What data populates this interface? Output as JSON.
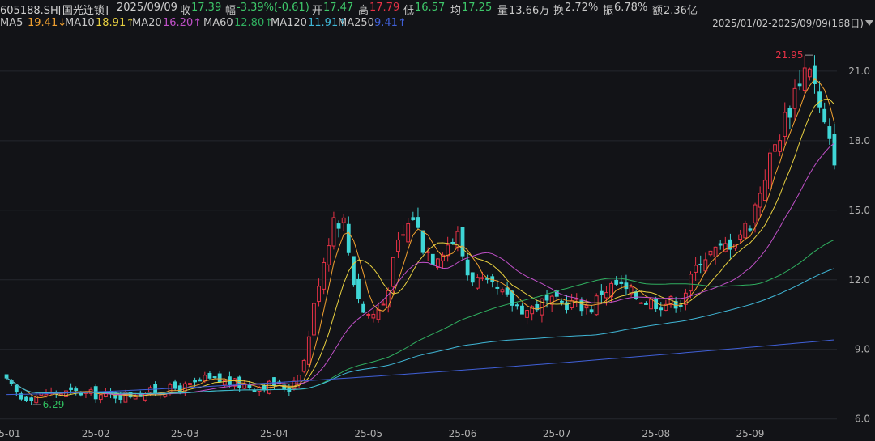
{
  "header": {
    "code": "605188.SH[国光连锁]",
    "date": "2025/09/09",
    "close_label": "收",
    "close": "17.39",
    "change_label": "幅",
    "change": "-3.39%(-0.61)",
    "open_label": "开",
    "open": "17.47",
    "high_label": "高",
    "high": "17.79",
    "low_label": "低",
    "low": "16.57",
    "avg_label": "均",
    "avg": "17.25",
    "volume_label": "量",
    "volume": "13.66万",
    "turnover_label": "换",
    "turnover": "2.72%",
    "amplitude_label": "振",
    "amplitude": "6.78%",
    "amount_label": "额",
    "amount": "2.36亿"
  },
  "ma_legend": [
    {
      "label": "MA5",
      "value": "19.41↓",
      "color": "#f0a030"
    },
    {
      "label": "MA10",
      "value": "18.91↑",
      "color": "#e8d040"
    },
    {
      "label": "MA20",
      "value": "16.20↑",
      "color": "#c050c8"
    },
    {
      "label": "MA60",
      "value": "12.80↑",
      "color": "#30b060"
    },
    {
      "label": "MA120",
      "value": "11.91↑",
      "color": "#40b8d8"
    },
    {
      "label": "MA250",
      "value": "9.41↑",
      "color": "#4060d8"
    }
  ],
  "range_label": "2025/01/02-2025/09/09(168日)",
  "chart_data": {
    "type": "candlestick",
    "y_ticks": [
      "21.0",
      "18.0",
      "15.0",
      "12.0",
      "9.0",
      "6.0"
    ],
    "y_tick_values": [
      21,
      18,
      15,
      12,
      9,
      6
    ],
    "ylim": [
      5.85,
      22.6
    ],
    "x_ticks": [
      "25-01",
      "25-02",
      "25-03",
      "25-04",
      "25-05",
      "25-06",
      "25-07",
      "25-08",
      "25-09"
    ],
    "x_tick_index": [
      0,
      18,
      36,
      54,
      73,
      92,
      111,
      131,
      150
    ],
    "n_days": 168,
    "max_label": "21.95",
    "min_label": "6.29",
    "colors": {
      "up": "#e63246",
      "down": "#3fd6d6",
      "grid": "#24272e",
      "axis_text": "#b0b0b0",
      "max_text": "#e63246",
      "min_text": "#30c060"
    },
    "anchors": [
      [
        0,
        7.6
      ],
      [
        3,
        6.9
      ],
      [
        8,
        7.1
      ],
      [
        14,
        7.15
      ],
      [
        20,
        7.0
      ],
      [
        25,
        7.05
      ],
      [
        30,
        7.2
      ],
      [
        37,
        7.4
      ],
      [
        40,
        7.7
      ],
      [
        44,
        7.6
      ],
      [
        50,
        7.4
      ],
      [
        54,
        7.5
      ],
      [
        57,
        7.3
      ],
      [
        60,
        8.5
      ],
      [
        63,
        12.0
      ],
      [
        66,
        14.7
      ],
      [
        68,
        14.5
      ],
      [
        70,
        12.0
      ],
      [
        72,
        10.6
      ],
      [
        74,
        10.5
      ],
      [
        76,
        11.0
      ],
      [
        79,
        13.5
      ],
      [
        82,
        14.8
      ],
      [
        84,
        13.5
      ],
      [
        86,
        13.0
      ],
      [
        88,
        13.4
      ],
      [
        91,
        13.9
      ],
      [
        93,
        12.3
      ],
      [
        96,
        11.8
      ],
      [
        99,
        11.5
      ],
      [
        102,
        11.0
      ],
      [
        105,
        10.7
      ],
      [
        108,
        11.0
      ],
      [
        111,
        11.0
      ],
      [
        115,
        11.0
      ],
      [
        118,
        10.8
      ],
      [
        120,
        11.5
      ],
      [
        123,
        11.8
      ],
      [
        126,
        11.4
      ],
      [
        129,
        11.1
      ],
      [
        132,
        11.0
      ],
      [
        136,
        11.1
      ],
      [
        138,
        12.0
      ],
      [
        140,
        13.0
      ],
      [
        144,
        13.3
      ],
      [
        147,
        13.8
      ],
      [
        150,
        14.5
      ],
      [
        153,
        16.6
      ],
      [
        156,
        18.4
      ],
      [
        158,
        19.5
      ],
      [
        160,
        20.8
      ],
      [
        162,
        21.4
      ],
      [
        164,
        19.3
      ],
      [
        166,
        17.8
      ],
      [
        167,
        17.39
      ]
    ]
  }
}
